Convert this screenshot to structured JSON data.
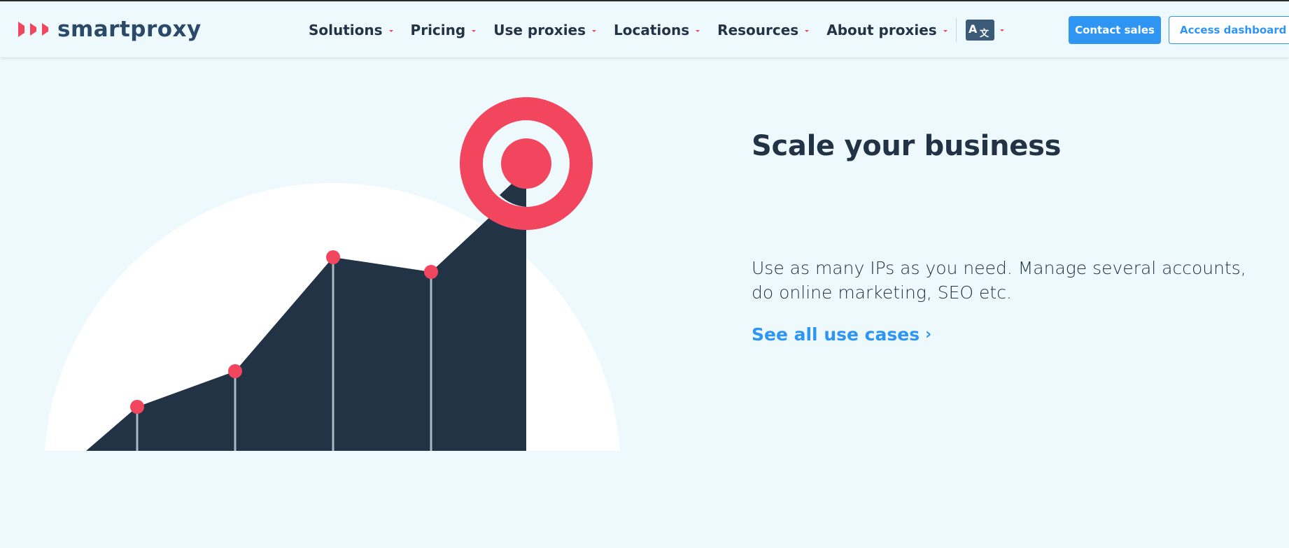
{
  "brand": {
    "name": "smartproxy",
    "accent_color": "#f2465f",
    "primary_color": "#2f95f3",
    "dark_color": "#223346"
  },
  "nav": {
    "items": [
      {
        "label": "Solutions"
      },
      {
        "label": "Pricing"
      },
      {
        "label": "Use proxies"
      },
      {
        "label": "Locations"
      },
      {
        "label": "Resources"
      },
      {
        "label": "About proxies"
      }
    ],
    "language_icon": "translate-icon",
    "language_icon_text": "A 文"
  },
  "header_buttons": {
    "contact": "Contact sales",
    "dashboard": "Access dashboard"
  },
  "content": {
    "title": "Scale your business",
    "description": "Use as many IPs as you need. Manage several accounts, do online marketing, SEO etc.",
    "cta": "See all use cases",
    "cta_icon": "chevron-right-icon"
  },
  "illustration": {
    "semantic": "growth-chart-target-illustration"
  }
}
